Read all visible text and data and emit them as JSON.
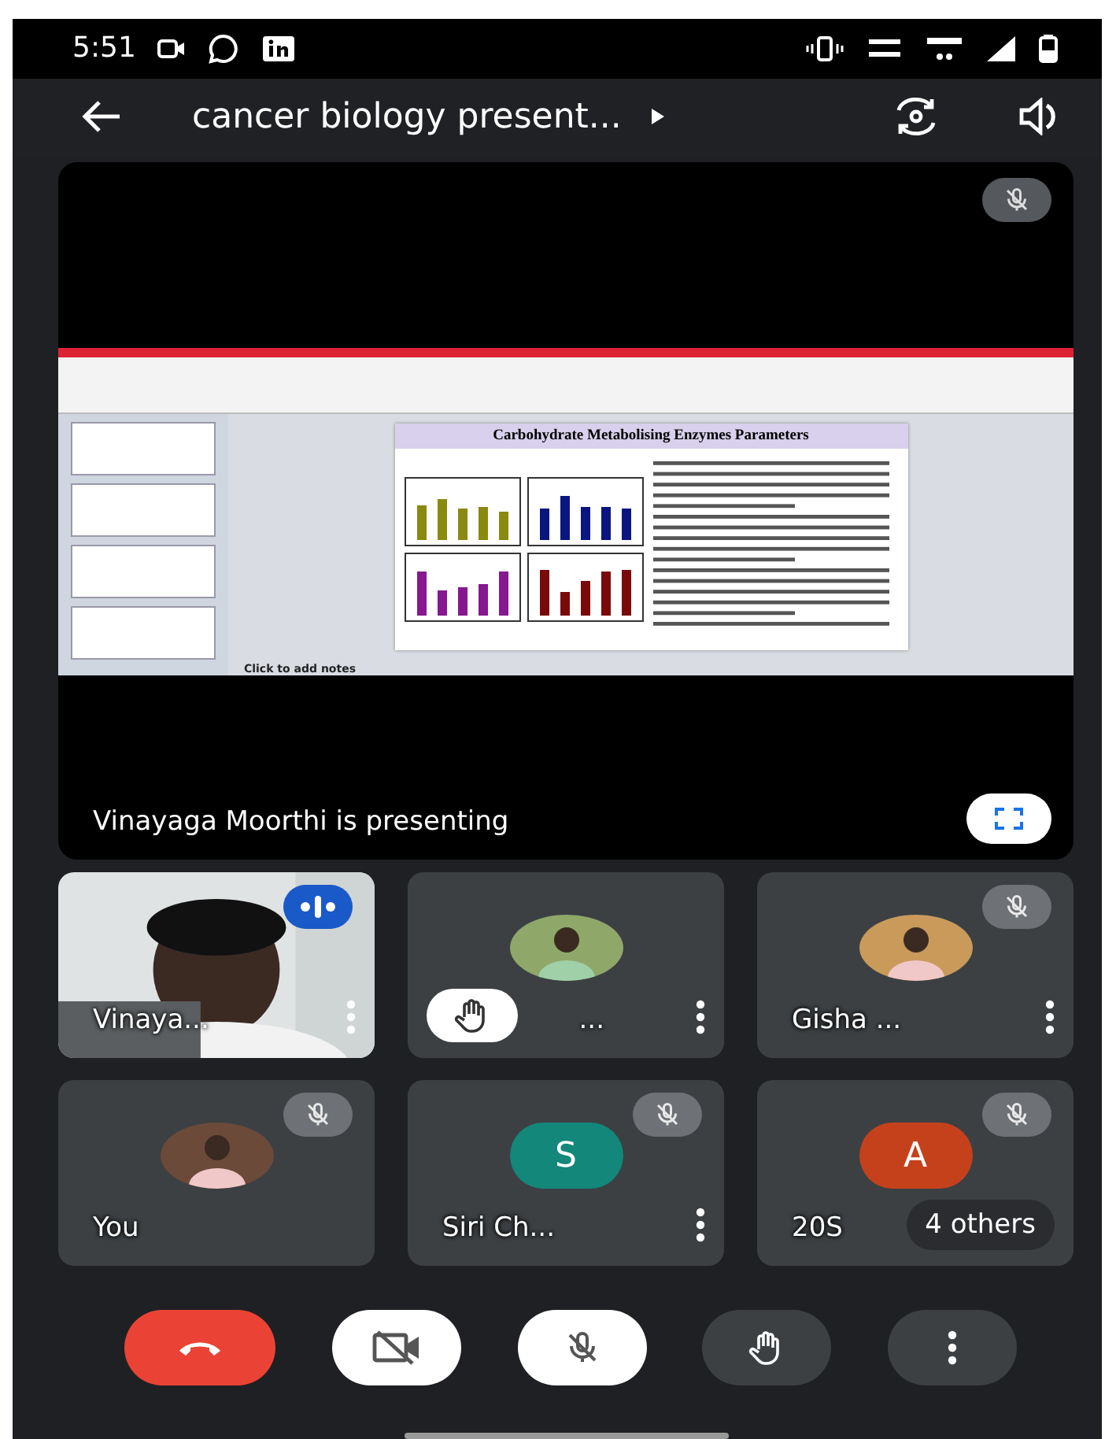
{
  "status_bar": {
    "time": "5:51"
  },
  "app_bar": {
    "title": "cancer biology present..."
  },
  "presentation": {
    "muted": true,
    "presenter_label": "Vinayaga Moorthi is presenting",
    "slide": {
      "title": "Carbohydrate Metabolising Enzymes Parameters",
      "notes_placeholder": "Click to add notes"
    }
  },
  "tiles": [
    {
      "name": "Vinaya...",
      "kind": "video",
      "speaking": true,
      "muted": false,
      "hand_raised": false,
      "menu": true
    },
    {
      "name": "...",
      "speaking": false,
      "muted": false,
      "hand_raised": true,
      "menu": true
    },
    {
      "name": "Gisha ...",
      "speaking": false,
      "muted": true,
      "hand_raised": false,
      "menu": true
    },
    {
      "name": "You",
      "speaking": false,
      "muted": true,
      "hand_raised": false,
      "menu": false
    },
    {
      "name": "Siri Ch...",
      "kind": "initial",
      "initial": "S",
      "color": "#12877a",
      "speaking": false,
      "muted": true,
      "hand_raised": false,
      "menu": true
    },
    {
      "name": "20S",
      "kind": "initial",
      "initial": "A",
      "color": "#c5411c",
      "speaking": false,
      "muted": true,
      "hand_raised": false,
      "menu": false,
      "overflow": "4 others"
    }
  ],
  "controls": [
    {
      "kind": "end"
    },
    {
      "kind": "camera",
      "on": false
    },
    {
      "kind": "mic",
      "on": false
    },
    {
      "kind": "hand"
    },
    {
      "kind": "more"
    }
  ]
}
